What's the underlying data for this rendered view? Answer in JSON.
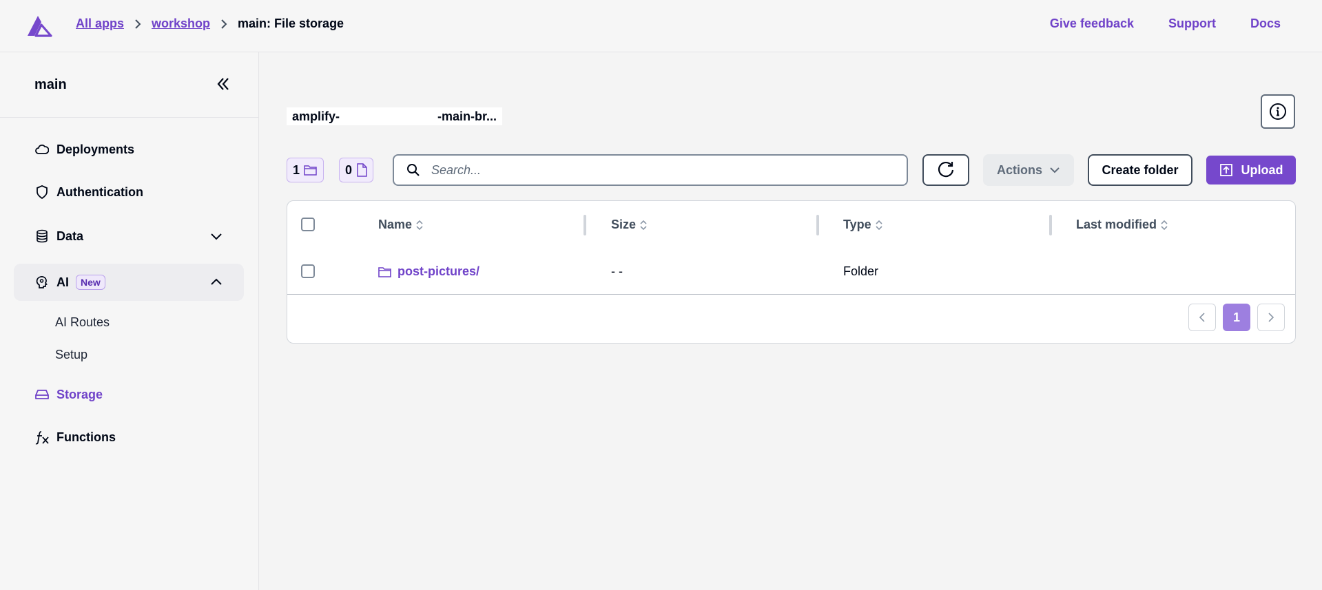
{
  "header": {
    "breadcrumbs": [
      {
        "label": "All apps"
      },
      {
        "label": "workshop"
      },
      {
        "label": "main: File storage"
      }
    ],
    "links": {
      "feedback": "Give feedback",
      "support": "Support",
      "docs": "Docs"
    }
  },
  "sidebar": {
    "title": "main",
    "items": {
      "deployments": "Deployments",
      "authentication": "Authentication",
      "data": "Data",
      "ai": "AI",
      "ai_badge": "New",
      "ai_routes": "AI Routes",
      "setup": "Setup",
      "storage": "Storage",
      "functions": "Functions"
    }
  },
  "main": {
    "bucket_prefix": "amplify-",
    "bucket_suffix": "-main-br...",
    "folder_count": "1",
    "file_count": "0",
    "search_placeholder": "Search...",
    "actions_label": "Actions",
    "create_folder_label": "Create folder",
    "upload_label": "Upload",
    "table": {
      "columns": {
        "name": "Name",
        "size": "Size",
        "type": "Type",
        "last_modified": "Last modified"
      },
      "rows": [
        {
          "name": "post-pictures/",
          "size": "- -",
          "type": "Folder",
          "last_modified": ""
        }
      ]
    },
    "pagination": {
      "current_page": "1"
    }
  },
  "colors": {
    "accent": "#7043c9",
    "primary_button": "#7648cc",
    "text": "#000716"
  }
}
